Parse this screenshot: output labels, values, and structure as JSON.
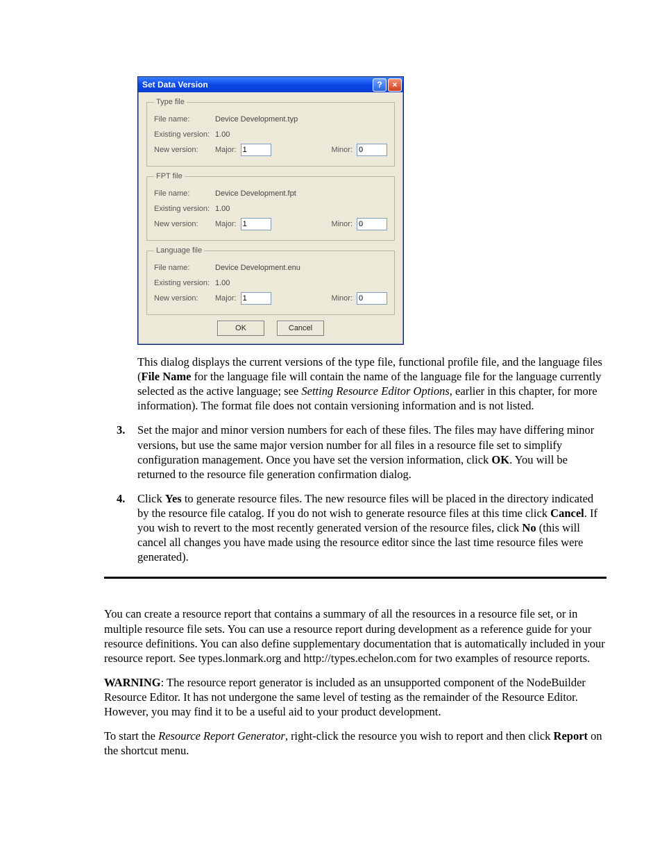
{
  "dialog": {
    "title": "Set Data Version",
    "groups": {
      "type": {
        "legend": "Type file",
        "file_label": "File name:",
        "file_value": "Device Development.typ",
        "existing_label": "Existing version:",
        "existing_value": "1.00",
        "new_label": "New version:",
        "major_label": "Major:",
        "major_value": "1",
        "minor_label": "Minor:",
        "minor_value": "0"
      },
      "fpt": {
        "legend": "FPT file",
        "file_label": "File name:",
        "file_value": "Device Development.fpt",
        "existing_label": "Existing version:",
        "existing_value": "1.00",
        "new_label": "New version:",
        "major_label": "Major:",
        "major_value": "1",
        "minor_label": "Minor:",
        "minor_value": "0"
      },
      "lang": {
        "legend": "Language file",
        "file_label": "File name:",
        "file_value": "Device Development.enu",
        "existing_label": "Existing version:",
        "existing_value": "1.00",
        "new_label": "New version:",
        "major_label": "Major:",
        "major_value": "1",
        "minor_label": "Minor:",
        "minor_value": "0"
      }
    },
    "ok": "OK",
    "cancel": "Cancel"
  },
  "text": {
    "p1a": "This dialog displays the current versions of the type file, functional profile file, and the language files (",
    "p1_bold1": "File Name",
    "p1b": " for the language file will contain the name of the language file for the language currently selected as the active language; see ",
    "p1_ital": "Setting Resource Editor Options",
    "p1c": ", earlier in this chapter, for more information).  The format file does not contain versioning information and is not listed.",
    "s3a": "Set the major and minor version numbers for each of these files.  The files may have differing minor versions, but use the same major version number for all files in a resource file set to simplify configuration management.  Once you have set the version information, click ",
    "s3_bold": "OK",
    "s3b": ".  You will be returned to the resource file generation confirmation dialog.",
    "s4a": "Click ",
    "s4_bold1": "Yes",
    "s4b": " to generate resource files.  The new resource files will be placed in the directory indicated by the resource file catalog.  If you do not wish to generate resource files at this time click ",
    "s4_bold2": "Cancel",
    "s4c": ".  If you wish to revert to the most recently generated version of the resource files, click ",
    "s4_bold3": "No",
    "s4d": " (this will cancel all changes you have made using the resource editor since the last time resource files were generated).",
    "p2": "You can create a resource report that contains a summary of all the resources in a resource file set, or in multiple resource file sets.  You can use a resource report during development as a reference guide for your resource definitions.  You can also define supplementary documentation that is automatically included in your resource report.  See types.lonmark.org and http://types.echelon.com for two examples of resource reports.",
    "p3_bold": "WARNING",
    "p3": ": The resource report generator is included as an unsupported component of the NodeBuilder Resource Editor.  It has not undergone the same level of testing as the remainder of the Resource Editor.  However, you may find it to be a useful aid to your product development.",
    "p4a": "To start the ",
    "p4_ital": "Resource Report Generator",
    "p4b": ", right-click the resource you wish to report and then click ",
    "p4_bold": "Report",
    "p4c": " on the shortcut menu."
  }
}
